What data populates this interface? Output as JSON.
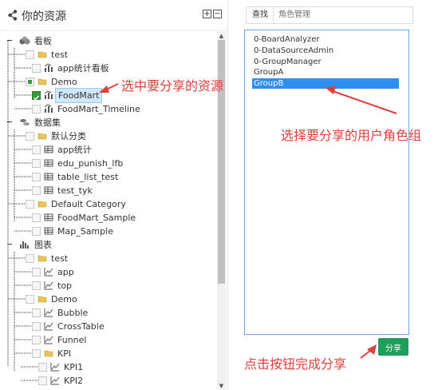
{
  "left": {
    "title": "你的资源",
    "expand_all": "+",
    "collapse_all": "−"
  },
  "tree": [
    {
      "label": "看板",
      "level": 0,
      "kind": "root",
      "icon": "dashboards-icon",
      "cb": "none"
    },
    {
      "label": "test",
      "level": 1,
      "kind": "folder",
      "icon": "folder-icon",
      "cb": "empty"
    },
    {
      "label": "app统计看板",
      "level": 2,
      "kind": "item",
      "icon": "dashboard-icon",
      "cb": "empty"
    },
    {
      "label": "Demo",
      "level": 1,
      "kind": "folder",
      "icon": "folder-icon",
      "cb": "partial"
    },
    {
      "label": "FoodMart",
      "level": 2,
      "kind": "item",
      "icon": "dashboard-icon",
      "cb": "checked",
      "selected": true
    },
    {
      "label": "FoodMart_Timeline",
      "level": 2,
      "kind": "item",
      "icon": "dashboard-icon",
      "cb": "empty"
    },
    {
      "label": "数据集",
      "level": 0,
      "kind": "root",
      "icon": "datasets-icon",
      "cb": "none"
    },
    {
      "label": "默认分类",
      "level": 1,
      "kind": "folder",
      "icon": "folder-icon",
      "cb": "empty"
    },
    {
      "label": "app统计",
      "level": 2,
      "kind": "item",
      "icon": "table-icon",
      "cb": "empty"
    },
    {
      "label": "edu_punish_lfb",
      "level": 2,
      "kind": "item",
      "icon": "table-icon",
      "cb": "empty"
    },
    {
      "label": "table_list_test",
      "level": 2,
      "kind": "item",
      "icon": "table-icon",
      "cb": "empty"
    },
    {
      "label": "test_tyk",
      "level": 2,
      "kind": "item",
      "icon": "table-icon",
      "cb": "empty"
    },
    {
      "label": "Default Category",
      "level": 1,
      "kind": "folder",
      "icon": "folder-icon",
      "cb": "empty"
    },
    {
      "label": "FoodMart_Sample",
      "level": 2,
      "kind": "item",
      "icon": "table-icon",
      "cb": "empty"
    },
    {
      "label": "Map_Sample",
      "level": 2,
      "kind": "item",
      "icon": "table-icon",
      "cb": "empty"
    },
    {
      "label": "图表",
      "level": 0,
      "kind": "root",
      "icon": "charts-icon",
      "cb": "none"
    },
    {
      "label": "test",
      "level": 1,
      "kind": "folder",
      "icon": "folder-icon",
      "cb": "empty"
    },
    {
      "label": "app",
      "level": 2,
      "kind": "item",
      "icon": "line-chart-icon",
      "cb": "empty"
    },
    {
      "label": "top",
      "level": 2,
      "kind": "item",
      "icon": "line-chart-icon",
      "cb": "empty"
    },
    {
      "label": "Demo",
      "level": 1,
      "kind": "folder",
      "icon": "folder-icon",
      "cb": "empty"
    },
    {
      "label": "Bubble",
      "level": 2,
      "kind": "item",
      "icon": "line-chart-icon",
      "cb": "empty"
    },
    {
      "label": "CrossTable",
      "level": 2,
      "kind": "item",
      "icon": "line-chart-icon",
      "cb": "empty"
    },
    {
      "label": "Funnel",
      "level": 2,
      "kind": "item",
      "icon": "line-chart-icon",
      "cb": "empty"
    },
    {
      "label": "KPI",
      "level": 2,
      "kind": "folder",
      "icon": "folder-icon",
      "cb": "empty"
    },
    {
      "label": "KPI1",
      "level": 3,
      "kind": "item",
      "icon": "line-chart-icon",
      "cb": "empty"
    },
    {
      "label": "KPI2",
      "level": 3,
      "kind": "item",
      "icon": "line-chart-icon",
      "cb": "empty"
    }
  ],
  "search": {
    "button": "查找",
    "placeholder": "角色管理"
  },
  "roles": [
    {
      "label": "0-BoardAnalyzer",
      "selected": false
    },
    {
      "label": "0-DataSourceAdmin",
      "selected": false
    },
    {
      "label": "0-GroupManager",
      "selected": false
    },
    {
      "label": "GroupA",
      "selected": false
    },
    {
      "label": "GroupB",
      "selected": true
    }
  ],
  "share_button": "分享",
  "annotations": {
    "select_resource": "选中要分享的资源",
    "select_role": "选择要分享的用户角色组",
    "click_share": "点击按钮完成分享"
  },
  "colors": {
    "accent_red": "#e0403c",
    "share_green": "#1e9d5b",
    "selection_blue": "#2f8ff0",
    "check_green": "#3a9a3a"
  }
}
